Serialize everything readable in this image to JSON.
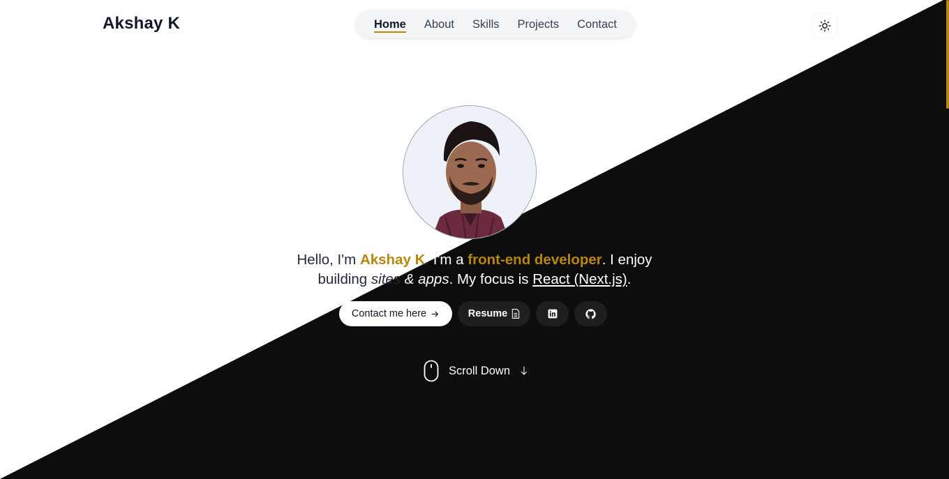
{
  "header": {
    "logo": "Akshay K",
    "nav": [
      {
        "label": "Home",
        "active": true
      },
      {
        "label": "About",
        "active": false
      },
      {
        "label": "Skills",
        "active": false
      },
      {
        "label": "Projects",
        "active": false
      },
      {
        "label": "Contact",
        "active": false
      }
    ],
    "theme_toggle_icon": "sun-icon"
  },
  "hero": {
    "avatar_alt": "Akshay K portrait",
    "intro": {
      "p1": "Hello, I'm ",
      "name": "Akshay K",
      "p2": ". I'm a ",
      "role": "front-end developer",
      "p3": ". I enjoy",
      "p4": "building ",
      "italic": "sites & apps",
      "p5": ". My focus is ",
      "focus": "React (Next.js)",
      "p6": "."
    },
    "buttons": {
      "contact": "Contact me here",
      "contact_icon": "arrow-right-icon",
      "resume": "Resume",
      "resume_icon": "document-icon",
      "linkedin_icon": "linkedin-icon",
      "github_icon": "github-icon"
    },
    "scroll_down": "Scroll Down"
  },
  "colors": {
    "accent": "#b8860b",
    "dark_bg": "#0d0d0d",
    "light_bg": "#ffffff"
  }
}
